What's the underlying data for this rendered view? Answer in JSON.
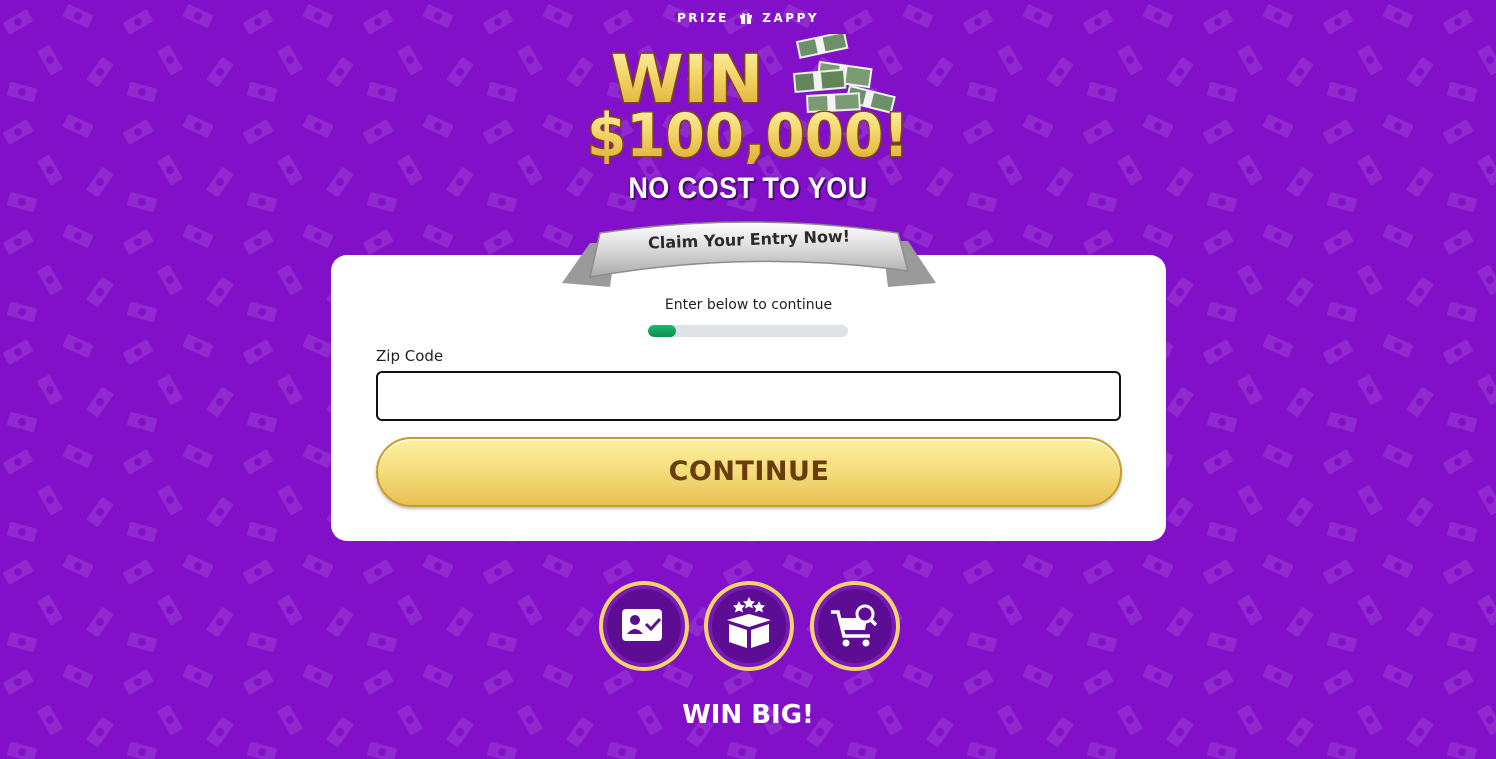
{
  "brand": {
    "left": "PRIZE",
    "right": "ZAPPY",
    "icon": "gift-icon"
  },
  "hero": {
    "win_line": "WIN",
    "amount_line": "$100,000!",
    "subtitle": "NO COST TO YOU",
    "banner": "Claim Your Entry Now!"
  },
  "form": {
    "intro": "Enter below to continue",
    "progress_fraction": 0.14,
    "zip_label": "Zip Code",
    "zip_value": "",
    "zip_placeholder": "",
    "continue_label": "CONTINUE"
  },
  "steps": [
    {
      "icon": "id-card-check-icon"
    },
    {
      "icon": "gift-box-stars-icon"
    },
    {
      "icon": "shopping-cart-search-icon"
    }
  ],
  "footer": {
    "headline": "WIN BIG!"
  },
  "colors": {
    "background": "#8210c8",
    "gold": "#f2d56a",
    "badge_fill": "#6a0fa8",
    "progress": "#12a05e",
    "button_text": "#6a3c0e"
  }
}
